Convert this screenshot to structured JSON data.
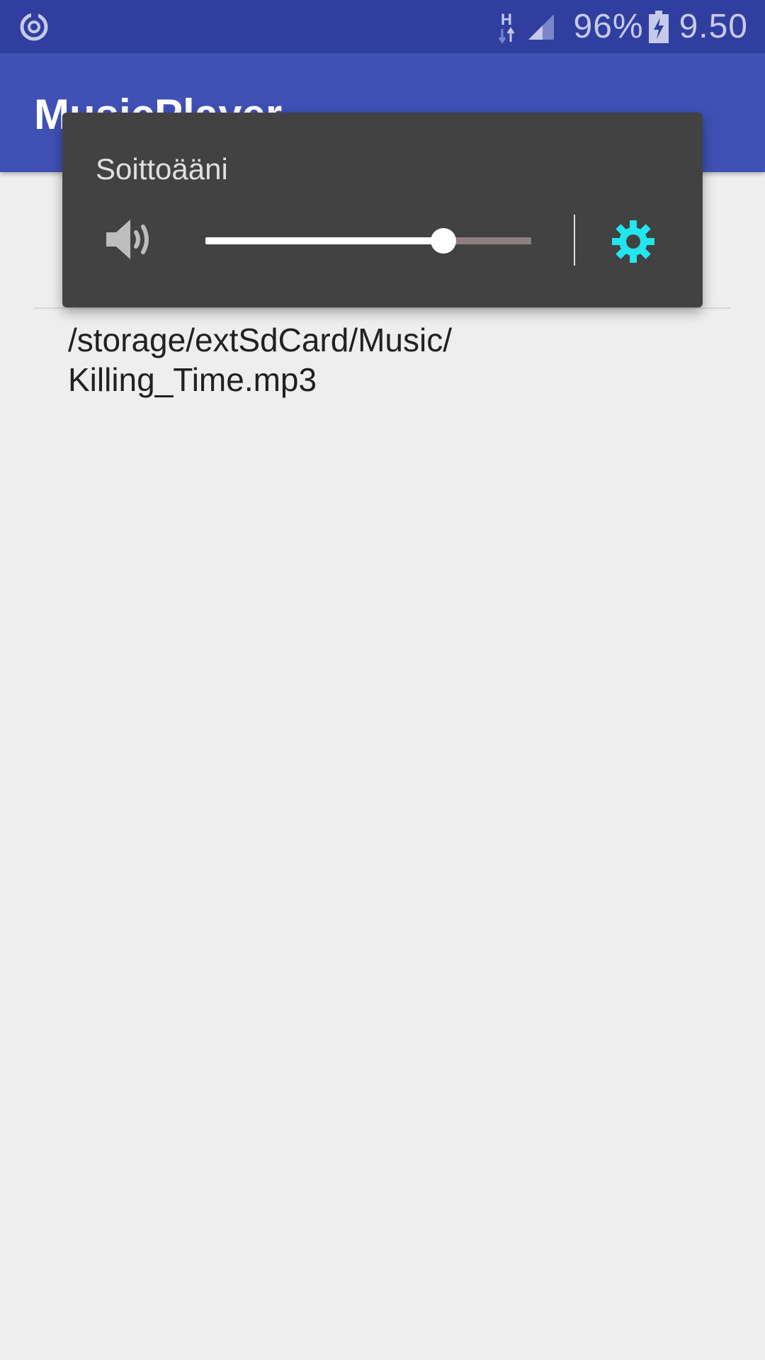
{
  "status_bar": {
    "left_icon": "sync-icon",
    "network_type": "H",
    "battery_percent": "96%",
    "time": "9.50",
    "icon_color": "#c5cae9",
    "background": "#303f9f"
  },
  "app_bar": {
    "title": "MusicPlayer",
    "background": "#3f51b5"
  },
  "main": {
    "track_path": "/storage/extSdCard/Music/\nKilling_Time.mp3"
  },
  "volume_panel": {
    "title": "Soittoääni",
    "stream_icon": "speaker-icon",
    "settings_icon": "gear-icon",
    "level": 0.73,
    "accent_color": "#22e5f0",
    "background": "#424242"
  }
}
